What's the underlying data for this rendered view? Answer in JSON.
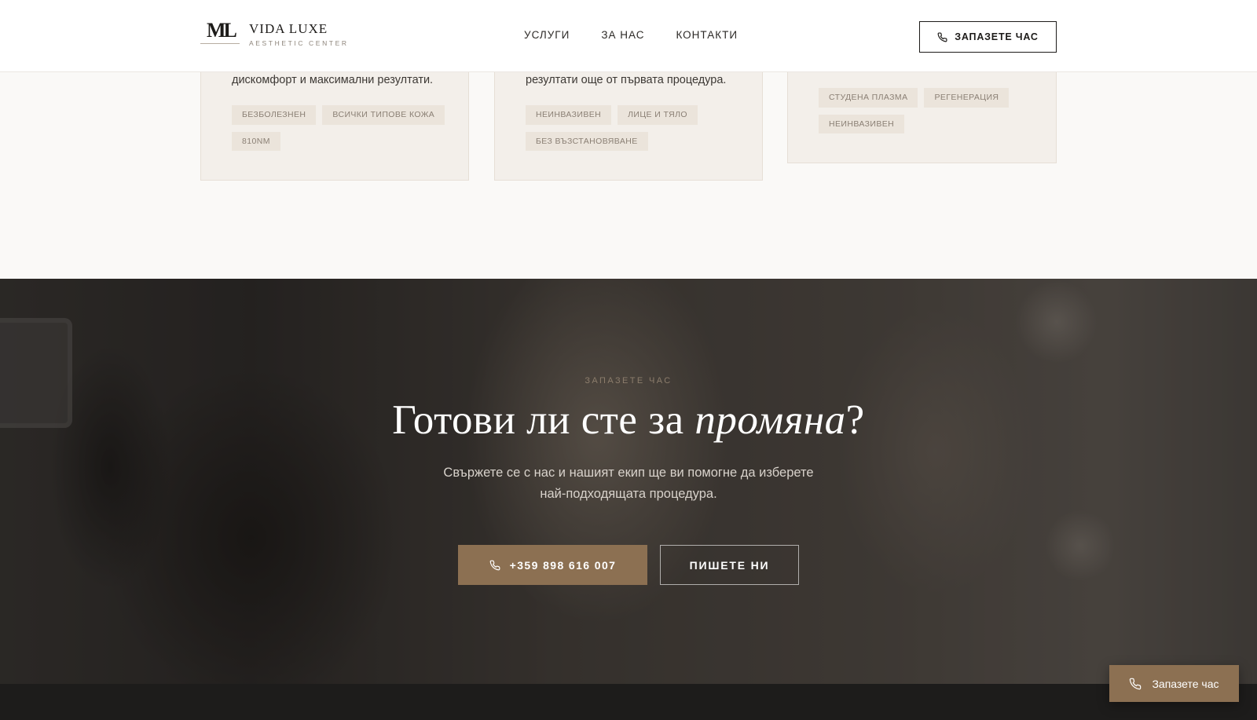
{
  "header": {
    "logo": {
      "mark": "ML",
      "name": "VIDA LUXE",
      "subtitle": "AESTHETIC CENTER"
    },
    "nav": [
      {
        "label": "УСЛУГИ"
      },
      {
        "label": "ЗА НАС"
      },
      {
        "label": "КОНТАКТИ"
      }
    ],
    "cta_label": "ЗАПАЗЕТЕ ЧАС",
    "cta_icon": "phone-icon"
  },
  "cards": [
    {
      "description": "дискомфорт и максимални резултати.",
      "tags": [
        "БЕЗБОЛЕЗНЕН",
        "ВСИЧКИ ТИПОВЕ КОЖА",
        "810NM"
      ]
    },
    {
      "description": "резултати още от първата процедура.",
      "tags": [
        "НЕИНВАЗИВЕН",
        "ЛИЦЕ И ТЯЛО",
        "БЕЗ ВЪЗСТАНОВЯВАНЕ"
      ]
    },
    {
      "tags": [
        "СТУДЕНА ПЛАЗМА",
        "РЕГЕНЕРАЦИЯ",
        "НЕИНВАЗИВЕН"
      ]
    }
  ],
  "hero": {
    "eyebrow": "ЗАПАЗЕТЕ ЧАС",
    "title_main": "Готови ли сте за ",
    "title_emphasis": "промяна",
    "title_end": "?",
    "text": "Свържете се с нас и нашият екип ще ви помогне да изберете най-подходящата процедура.",
    "phone_button": "+359 898 616 007",
    "write_button": "ПИШЕТЕ НИ",
    "accent_color": "#8c7052"
  },
  "floating_button": {
    "label": "Запазете час",
    "icon": "phone-icon"
  }
}
